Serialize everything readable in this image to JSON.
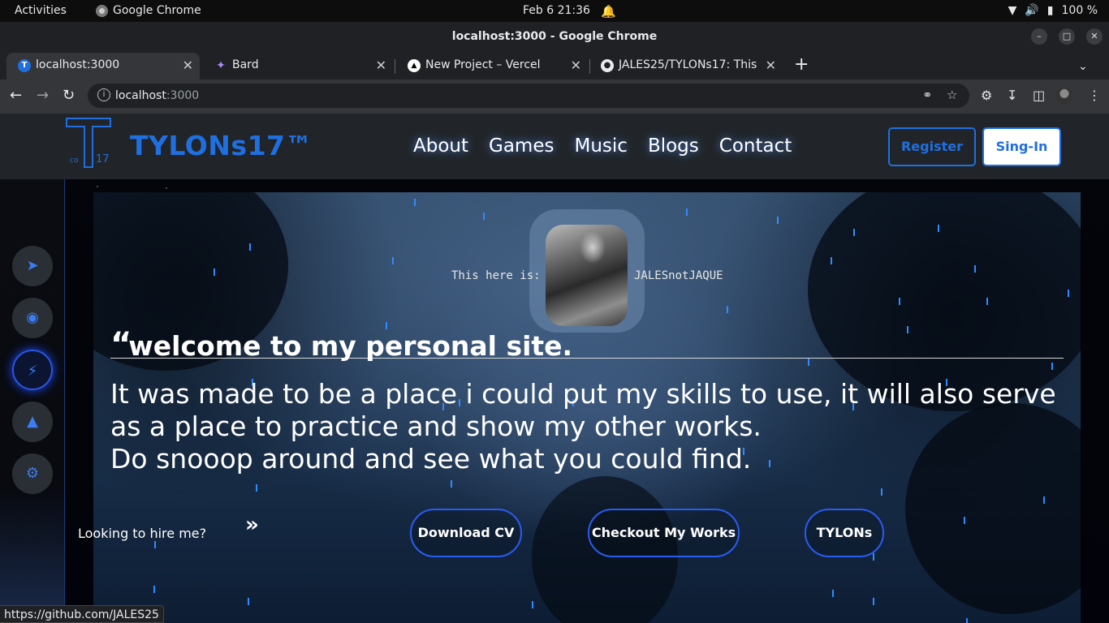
{
  "gnome": {
    "activities": "Activities",
    "app_name": "Google Chrome",
    "clock": "Feb 6  21:36",
    "battery": "100 %"
  },
  "window": {
    "title": "localhost:3000 - Google Chrome"
  },
  "tabs": [
    {
      "label": "localhost:3000",
      "active": true
    },
    {
      "label": "Bard",
      "active": false
    },
    {
      "label": "New Project – Vercel",
      "active": false
    },
    {
      "label": "JALES25/TYLONs17: This",
      "active": false
    }
  ],
  "omnibox": {
    "host": "localhost",
    "port": ":3000"
  },
  "site": {
    "brand": "TYLONs17™",
    "logo_sub_left": "co",
    "logo_sub_right": "17",
    "nav": [
      "About",
      "Games",
      "Music",
      "Blogs",
      "Contact"
    ],
    "register": "Register",
    "signin": "Sing-In"
  },
  "hero": {
    "intro_left": "This here is:",
    "intro_right": "JALESnotJAQUE",
    "quote_mark": "“",
    "welcome": "welcome to my personal site.",
    "body_line1": "It was made to be a place i could put my skills to use, it will also serve as a place to practice and show my other works.",
    "body_line2": "Do snooop around and see what you could find.",
    "hire_text": "Looking to hire me?",
    "hire_arrow": "»",
    "cta_cv": "Download CV",
    "cta_works": "Checkout My Works",
    "cta_tylons": "TYLONs"
  },
  "status_bar": "https://github.com/JALES25",
  "colors": {
    "accent": "#1f6fe0",
    "rain": "#2f8cff",
    "header_bg": "#212529"
  }
}
